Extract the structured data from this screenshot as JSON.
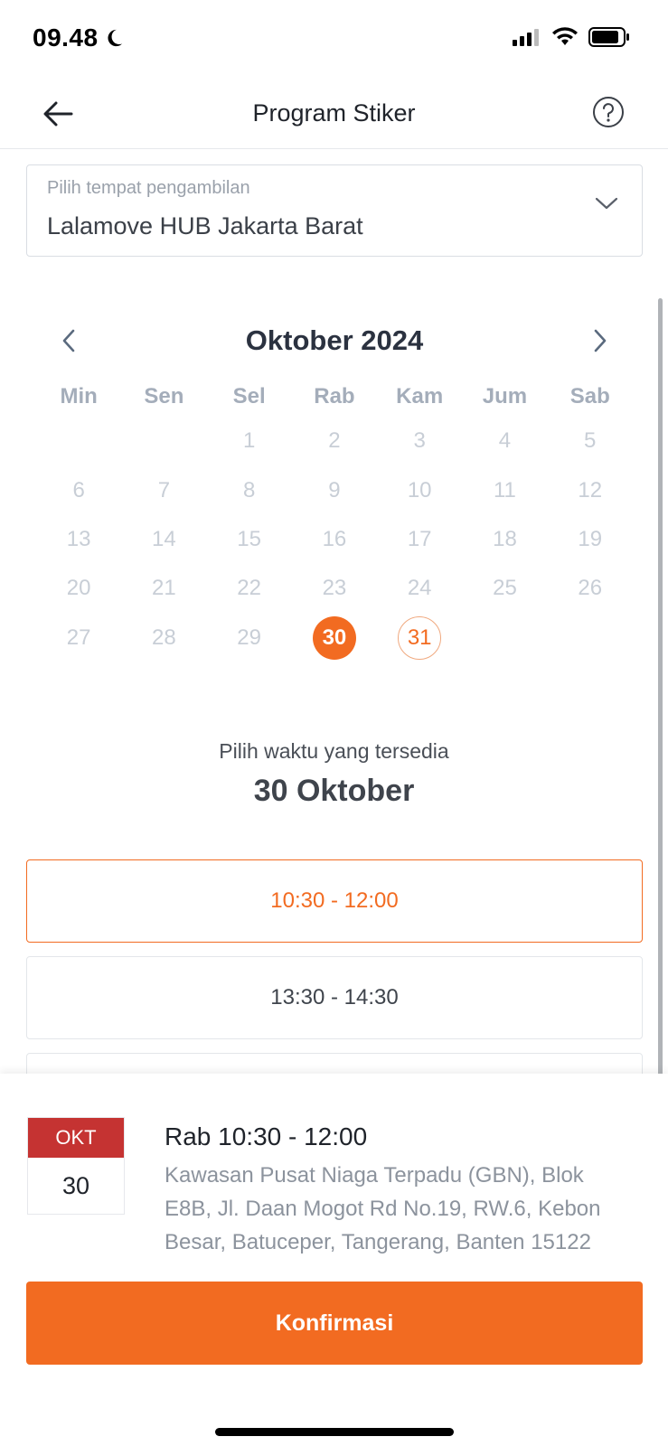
{
  "status_bar": {
    "time": "09.48"
  },
  "header": {
    "title": "Program Stiker"
  },
  "location": {
    "label": "Pilih tempat pengambilan",
    "value": "Lalamove HUB Jakarta Barat"
  },
  "calendar": {
    "month": "Oktober 2024",
    "weekdays": [
      "Min",
      "Sen",
      "Sel",
      "Rab",
      "Kam",
      "Jum",
      "Sab"
    ],
    "weeks": [
      [
        "",
        "",
        "1",
        "2",
        "3",
        "4",
        "5"
      ],
      [
        "6",
        "7",
        "8",
        "9",
        "10",
        "11",
        "12"
      ],
      [
        "13",
        "14",
        "15",
        "16",
        "17",
        "18",
        "19"
      ],
      [
        "20",
        "21",
        "22",
        "23",
        "24",
        "25",
        "26"
      ],
      [
        "27",
        "28",
        "29",
        "30",
        "31",
        "",
        ""
      ]
    ],
    "selected_day": "30",
    "available_days": [
      "30",
      "31"
    ]
  },
  "time_section": {
    "subtitle": "Pilih waktu yang tersedia",
    "date": "30 Oktober",
    "slots": [
      "10:30 - 12:00",
      "13:30 - 14:30",
      ""
    ],
    "selected_slot": "10:30 - 12:00"
  },
  "summary": {
    "badge_month": "OKT",
    "badge_day": "30",
    "time": "Rab 10:30 - 12:00",
    "address": "Kawasan Pusat Niaga Terpadu (GBN), Blok E8B, Jl. Daan Mogot Rd No.19, RW.6, Kebon Besar, Batuceper, Tangerang, Banten 15122"
  },
  "confirm_label": "Konfirmasi",
  "colors": {
    "accent": "#f26b21",
    "badge_red": "#c53332",
    "muted": "#c8ced6"
  }
}
